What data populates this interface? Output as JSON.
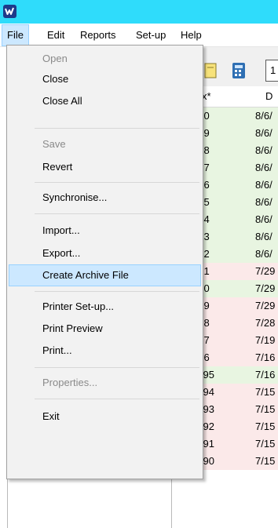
{
  "menubar": {
    "items": [
      {
        "label": "File"
      },
      {
        "label": "Edit"
      },
      {
        "label": "Reports"
      },
      {
        "label": "Set-up"
      },
      {
        "label": "Help"
      }
    ]
  },
  "file_menu": {
    "items": [
      {
        "label": "Open",
        "enabled": false
      },
      {
        "label": "Close",
        "enabled": true
      },
      {
        "label": "Close All",
        "enabled": true
      },
      {
        "label": "Save",
        "enabled": false
      },
      {
        "label": "Revert",
        "enabled": true
      },
      {
        "label": "Synchronise...",
        "enabled": true
      },
      {
        "label": "Import...",
        "enabled": true
      },
      {
        "label": "Export...",
        "enabled": true
      },
      {
        "label": "Create Archive File",
        "enabled": true,
        "highlighted": true
      },
      {
        "label": "Printer Set-up...",
        "enabled": true
      },
      {
        "label": "Print Preview",
        "enabled": true
      },
      {
        "label": "Print...",
        "enabled": true
      },
      {
        "label": "Properties...",
        "enabled": false
      },
      {
        "label": "Exit",
        "enabled": true
      }
    ]
  },
  "toolbar": {
    "partial_label": "1"
  },
  "table": {
    "columns": [
      "x*",
      "D"
    ],
    "rows": [
      {
        "id": "210",
        "date": "8/6/",
        "status": "ok"
      },
      {
        "id": "209",
        "date": "8/6/",
        "status": "ok"
      },
      {
        "id": "208",
        "date": "8/6/",
        "status": "ok"
      },
      {
        "id": "207",
        "date": "8/6/",
        "status": "ok"
      },
      {
        "id": "206",
        "date": "8/6/",
        "status": "ok"
      },
      {
        "id": "205",
        "date": "8/6/",
        "status": "ok"
      },
      {
        "id": "204",
        "date": "8/6/",
        "status": "ok"
      },
      {
        "id": "203",
        "date": "8/6/",
        "status": "ok"
      },
      {
        "id": "202",
        "date": "8/6/",
        "status": "ok"
      },
      {
        "id": "201",
        "date": "7/29",
        "status": "fail"
      },
      {
        "id": "200",
        "date": "7/29",
        "status": "ok"
      },
      {
        "id": "199",
        "date": "7/29",
        "status": "fail"
      },
      {
        "id": "198",
        "date": "7/28",
        "status": "fail"
      },
      {
        "id": "197",
        "date": "7/19",
        "status": "fail"
      },
      {
        "id": "196",
        "date": "7/16",
        "status": "fail"
      },
      {
        "id": "1195",
        "date": "7/16",
        "status": "ok"
      },
      {
        "id": "1194",
        "date": "7/15",
        "status": "fail"
      },
      {
        "id": "1193",
        "date": "7/15",
        "status": "fail"
      },
      {
        "id": "1192",
        "date": "7/15",
        "status": "fail"
      },
      {
        "id": "1191",
        "date": "7/15",
        "status": "fail"
      },
      {
        "id": "1190",
        "date": "7/15",
        "status": "fail"
      }
    ]
  },
  "colors": {
    "titlebar": "#2fdcfb",
    "row_ok": "#e8f5e1",
    "row_fail": "#fbe9e9",
    "fail_icon": "#d9241c",
    "ok_icon": "#3aa53a",
    "menu_highlight": "#cce8ff"
  }
}
